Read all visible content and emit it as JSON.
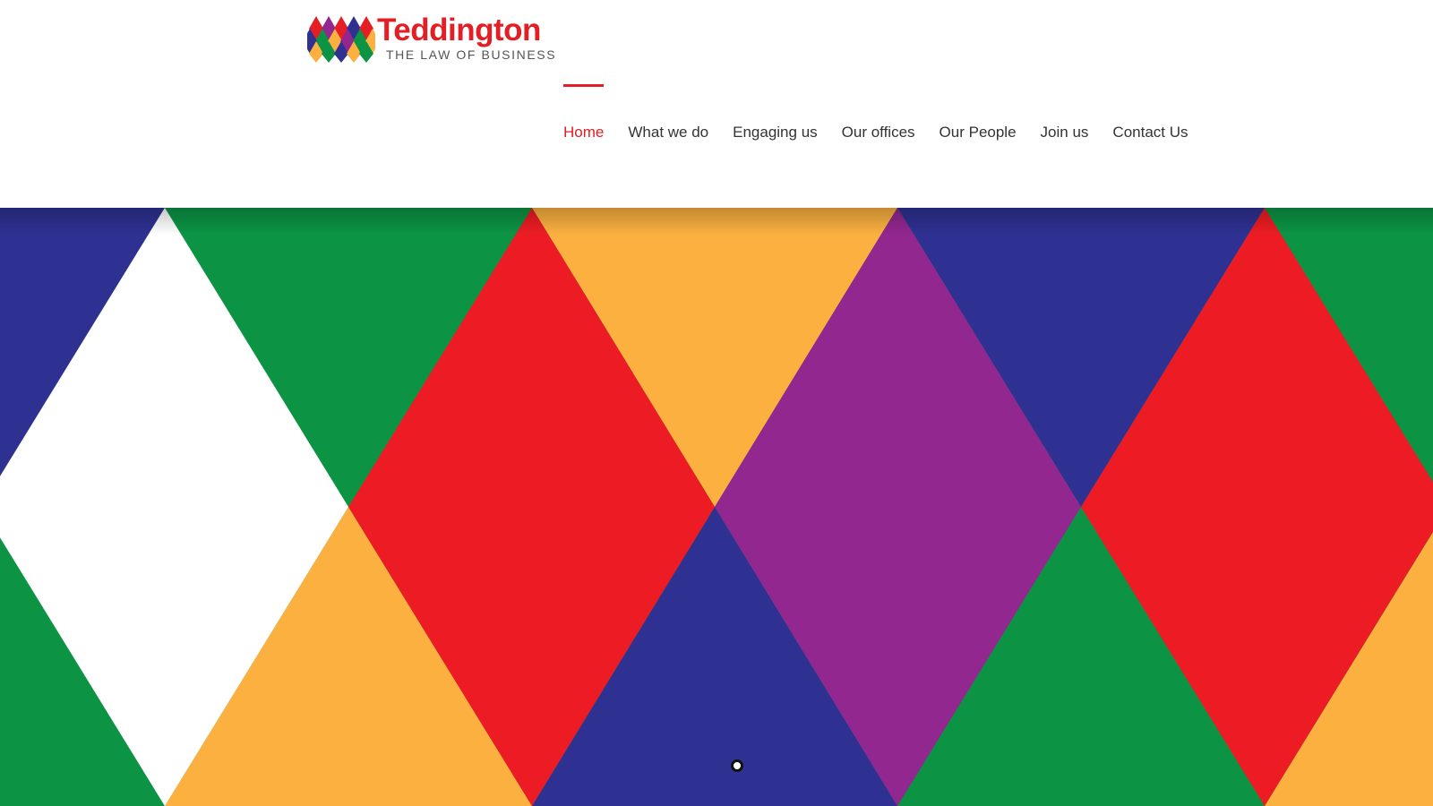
{
  "brand": {
    "name": "Teddington",
    "tagline": "THE LAW OF BUSINESS",
    "logo_colors": [
      "#e31e24",
      "#0c9444",
      "#2e3192",
      "#92278f",
      "#fbb040"
    ]
  },
  "nav": {
    "active_index": 0,
    "items": [
      {
        "label": "Home"
      },
      {
        "label": "What we do"
      },
      {
        "label": "Engaging us"
      },
      {
        "label": "Our offices"
      },
      {
        "label": "Our People"
      },
      {
        "label": "Join us"
      },
      {
        "label": "Contact Us"
      }
    ]
  },
  "hero": {
    "pattern": "harlequin-diamonds",
    "colors": {
      "blue": "#2e3192",
      "green": "#0c9444",
      "red": "#ed1c24",
      "orange": "#fbb040",
      "purple": "#92278f",
      "white": "#ffffff"
    },
    "slides": 1,
    "active_slide": 0
  },
  "colors": {
    "accent": "#e31e24",
    "nav_text": "#333333"
  }
}
